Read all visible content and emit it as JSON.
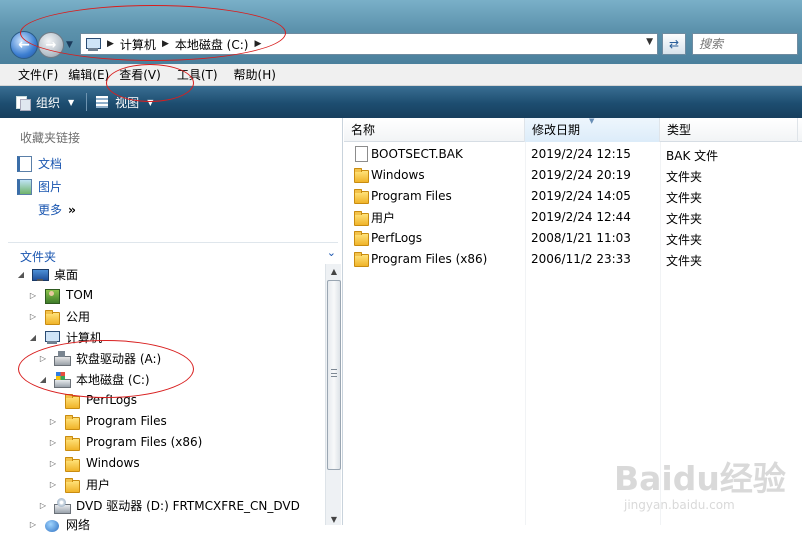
{
  "address_bar": {
    "breadcrumbs": [
      "计算机",
      "本地磁盘 (C:)"
    ],
    "search_placeholder": "搜索"
  },
  "menu": [
    "文件(F)",
    "编辑(E)",
    "查看(V)",
    "工具(T)",
    "帮助(H)"
  ],
  "command_bar": {
    "organize_label": "组织",
    "view_label": "视图"
  },
  "left_pane": {
    "favorites_title": "收藏夹链接",
    "favorites": [
      {
        "label": "文档",
        "icon": "document-icon"
      },
      {
        "label": "图片",
        "icon": "picture-icon"
      },
      {
        "label": "更多",
        "icon": "chevron-double-right-icon"
      }
    ],
    "folders_title": "文件夹",
    "tree": [
      {
        "label": "桌面",
        "icon": "desktop-icon",
        "expander": "expanded"
      },
      {
        "label": "TOM",
        "icon": "user-folder-icon",
        "expander": "collapsed"
      },
      {
        "label": "公用",
        "icon": "folder-icon",
        "expander": "collapsed"
      },
      {
        "label": "计算机",
        "icon": "computer-icon",
        "expander": "expanded"
      },
      {
        "label": "软盘驱动器 (A:)",
        "icon": "floppy-drive-icon",
        "expander": "collapsed"
      },
      {
        "label": "本地磁盘 (C:)",
        "icon": "local-disk-icon",
        "expander": "expanded"
      },
      {
        "label": "PerfLogs",
        "icon": "folder-icon",
        "expander": "none"
      },
      {
        "label": "Program Files",
        "icon": "folder-icon",
        "expander": "collapsed"
      },
      {
        "label": "Program Files (x86)",
        "icon": "folder-icon",
        "expander": "collapsed"
      },
      {
        "label": "Windows",
        "icon": "folder-icon",
        "expander": "collapsed"
      },
      {
        "label": "用户",
        "icon": "folder-icon",
        "expander": "collapsed"
      },
      {
        "label": "DVD 驱动器 (D:) FRTMCXFRE_CN_DVD",
        "icon": "dvd-drive-icon",
        "expander": "collapsed"
      },
      {
        "label": "网络",
        "icon": "network-icon",
        "expander": "collapsed"
      }
    ]
  },
  "file_list": {
    "columns": [
      "名称",
      "修改日期",
      "类型"
    ],
    "sorted_column": "修改日期",
    "rows": [
      {
        "name": "BOOTSECT.BAK",
        "date": "2019/2/24 12:15",
        "type": "BAK 文件",
        "icon": "file-icon"
      },
      {
        "name": "Windows",
        "date": "2019/2/24 20:19",
        "type": "文件夹",
        "icon": "folder-icon"
      },
      {
        "name": "Program Files",
        "date": "2019/2/24 14:05",
        "type": "文件夹",
        "icon": "folder-icon"
      },
      {
        "name": "用户",
        "date": "2019/2/24 12:44",
        "type": "文件夹",
        "icon": "folder-icon"
      },
      {
        "name": "PerfLogs",
        "date": "2008/1/21 11:03",
        "type": "文件夹",
        "icon": "folder-icon"
      },
      {
        "name": "Program Files (x86)",
        "date": "2006/11/2 23:33",
        "type": "文件夹",
        "icon": "folder-icon"
      }
    ]
  },
  "watermark": {
    "main": "Baidu经验",
    "sub": "jingyan.baidu.com"
  },
  "colors": {
    "annotation_red": "#d81e1e",
    "link_blue": "#1a56b0",
    "command_bar": "#1d4d70"
  }
}
